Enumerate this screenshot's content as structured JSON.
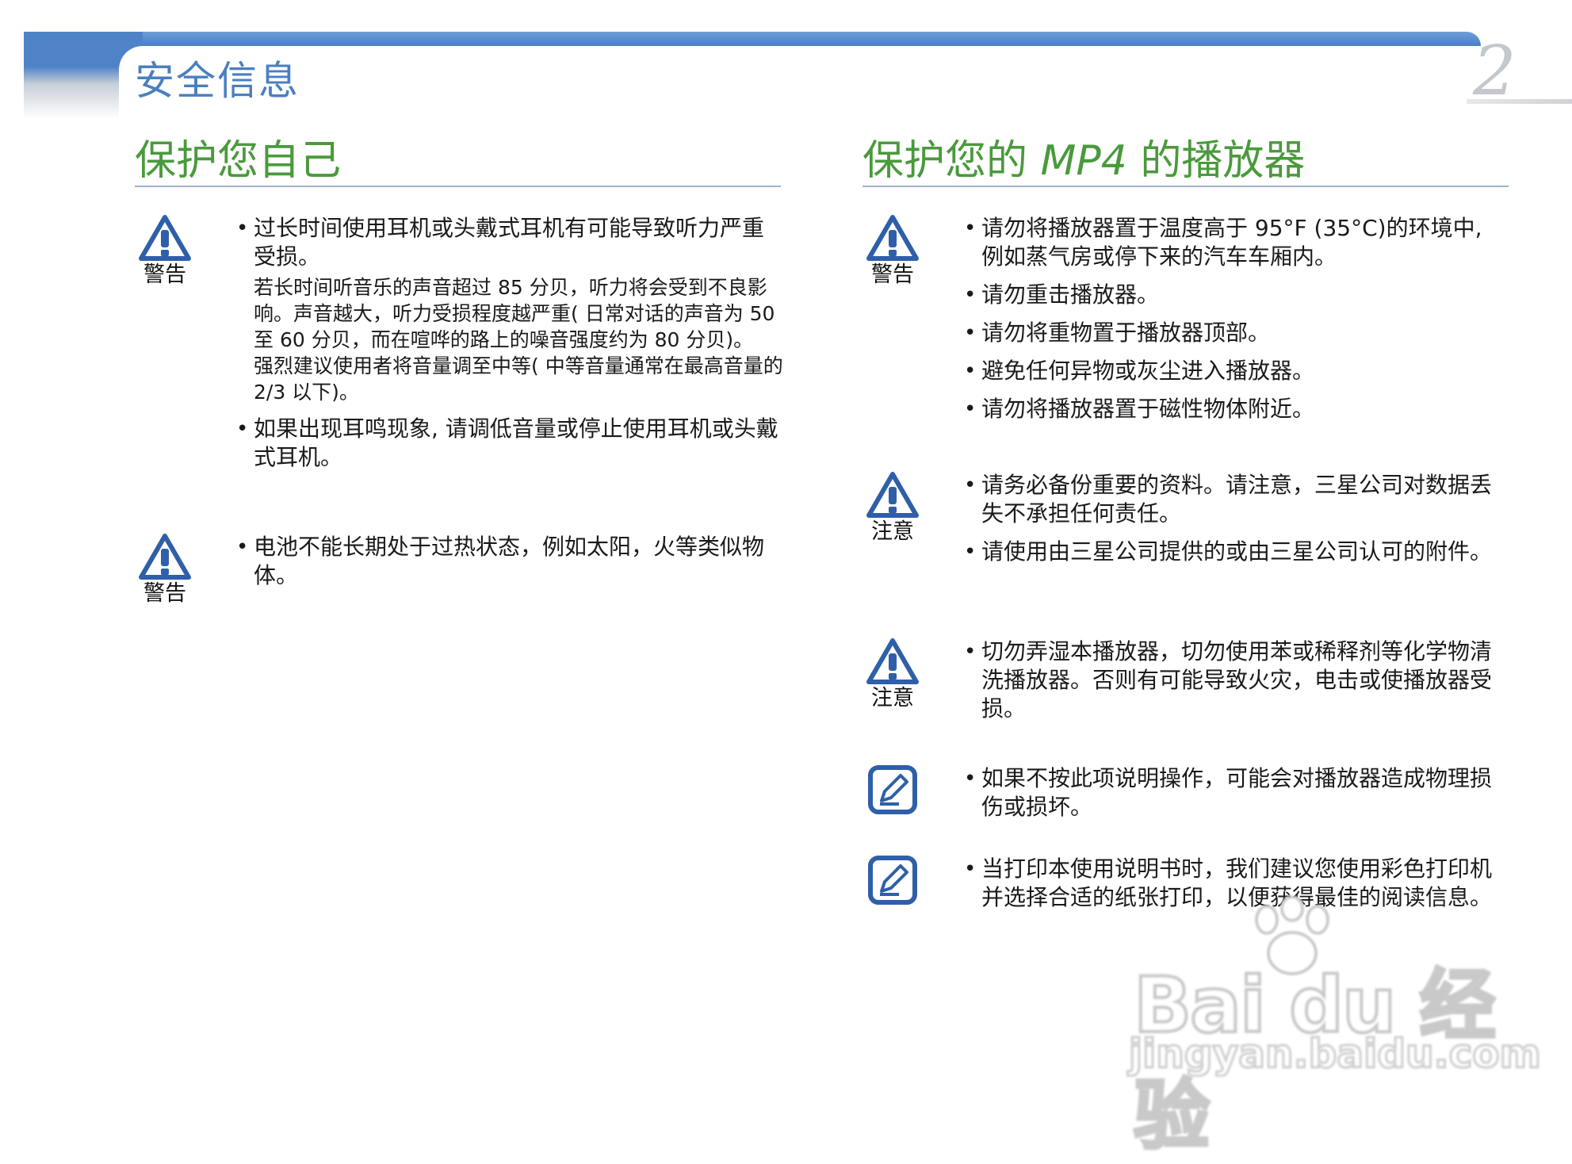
{
  "header": {
    "section_title": "安全信息",
    "page_number": "2"
  },
  "left_column": {
    "title": "保护您自己",
    "blocks": [
      {
        "icon": "warning-icon",
        "icon_label": "警告",
        "items": [
          {
            "text": "过长时间使用耳机或头戴式耳机有可能导致听力严重受损。",
            "sub": [
              "若长时间听音乐的声音超过 85 分贝，听力将会受到不良影响。声音越大，听力受损程度越严重( 日常对话的声音为 50 至 60 分贝，而在喧哗的路上的噪音强度约为 80 分贝)。",
              "强烈建议使用者将音量调至中等( 中等音量通常在最高音量的 2/3 以下)。"
            ]
          },
          {
            "text": "如果出现耳鸣现象, 请调低音量或停止使用耳机或头戴式耳机。"
          }
        ]
      },
      {
        "icon": "warning-icon",
        "icon_label": "警告",
        "items": [
          {
            "text": "电池不能长期处于过热状态，例如太阳，火等类似物体。"
          }
        ]
      }
    ]
  },
  "right_column": {
    "title_prefix": "保护您的 ",
    "title_model": "MP4",
    "title_suffix": " 的播放器",
    "blocks": [
      {
        "icon": "warning-icon",
        "icon_label": "警告",
        "items": [
          {
            "text": "请勿将播放器置于温度高于 95°F (35°C)的环境中, 例如蒸气房或停下来的汽车车厢内。"
          },
          {
            "text": "请勿重击播放器。"
          },
          {
            "text": "请勿将重物置于播放器顶部。"
          },
          {
            "text": "避免任何异物或灰尘进入播放器。"
          },
          {
            "text": "请勿将播放器置于磁性物体附近。"
          }
        ]
      },
      {
        "icon": "caution-icon",
        "icon_label": "注意",
        "items": [
          {
            "text": "请务必备份重要的资料。请注意，三星公司对数据丢失不承担任何责任。"
          },
          {
            "text": "请使用由三星公司提供的或由三星公司认可的附件。"
          }
        ]
      },
      {
        "icon": "caution-icon",
        "icon_label": "注意",
        "items": [
          {
            "text": "切勿弄湿本播放器，切勿使用苯或稀释剂等化学物清洗播放器。否则有可能导致火灾，电击或使播放器受损。"
          }
        ]
      },
      {
        "icon": "note-icon",
        "items": [
          {
            "text": "如果不按此项说明操作，可能会对播放器造成物理损伤或损坏。"
          }
        ]
      },
      {
        "icon": "note-icon",
        "items": [
          {
            "text": "当打印本使用说明书时，我们建议您使用彩色打印机并选择合适的纸张打印，以便获得最佳的阅读信息。"
          }
        ]
      }
    ]
  },
  "watermark": {
    "logo_text": "Bai du 经验",
    "url": "jingyan.baidu.com"
  },
  "colors": {
    "header_blue": "#4a7fbf",
    "title_green": "#4a9a3c",
    "icon_blue": "#2f5fa8"
  }
}
